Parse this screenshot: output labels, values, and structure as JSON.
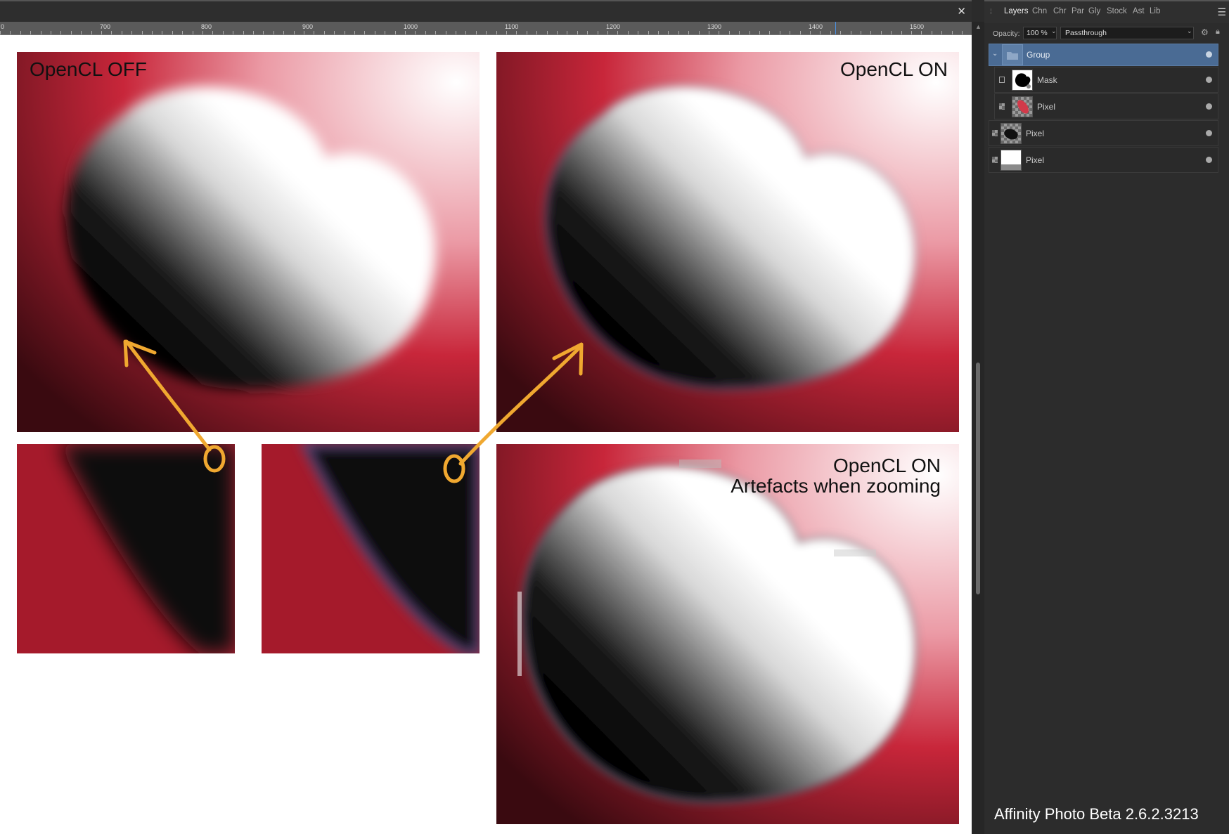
{
  "canvas": {
    "close_icon": "close-icon",
    "ruler_ticks": [
      "0",
      "700",
      "800",
      "900",
      "1000",
      "1100",
      "1200",
      "1300",
      "1400",
      "1500"
    ],
    "images": {
      "top_left_label": "OpenCL OFF",
      "top_right_label": "OpenCL ON",
      "bottom_right_label_line1": "OpenCL ON",
      "bottom_right_label_line2": "Artefacts when zooming"
    },
    "colors": {
      "red": "#c8263a",
      "pink": "#eb9aa5",
      "arrow": "#f0a830"
    }
  },
  "panel": {
    "tabs": [
      "Layers",
      "Chn",
      "Chr",
      "Par",
      "Gly",
      "Stock",
      "Ast",
      "Lib"
    ],
    "active_tab": "Layers",
    "opacity_label": "Opacity:",
    "opacity_value": "100 %",
    "blend_mode": "Passthrough",
    "layers": [
      {
        "name": "Group",
        "kind": "group",
        "selected": true
      },
      {
        "name": "Mask",
        "kind": "mask",
        "selected": false
      },
      {
        "name": "Pixel",
        "kind": "pixel-red",
        "selected": false
      },
      {
        "name": "Pixel",
        "kind": "pixel-black",
        "selected": false
      },
      {
        "name": "Pixel",
        "kind": "pixel-white",
        "selected": false
      }
    ],
    "footer_text": "Affinity Photo Beta 2.6.2.3213"
  }
}
